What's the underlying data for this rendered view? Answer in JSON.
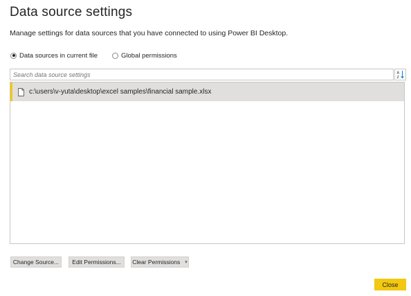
{
  "dialog": {
    "title": "Data source settings",
    "subtitle": "Manage settings for data sources that you have connected to using Power BI Desktop."
  },
  "scope": {
    "options": [
      {
        "label": "Data sources in current file",
        "selected": true
      },
      {
        "label": "Global permissions",
        "selected": false
      }
    ]
  },
  "search": {
    "placeholder": "Search data source settings",
    "value": ""
  },
  "sort_button": {
    "icon": "sort-az-icon"
  },
  "data_sources": [
    {
      "path": "c:\\users\\v-yuta\\desktop\\excel samples\\financial sample.xlsx",
      "icon": "file-icon",
      "selected": true
    }
  ],
  "actions": {
    "change_source": "Change Source...",
    "edit_permissions": "Edit Permissions...",
    "clear_permissions": "Clear Permissions",
    "close": "Close"
  },
  "colors": {
    "accent": "#f2c811",
    "selected_row": "#e1dfdd",
    "button_bg": "#e1dfdd",
    "text": "#252423"
  }
}
